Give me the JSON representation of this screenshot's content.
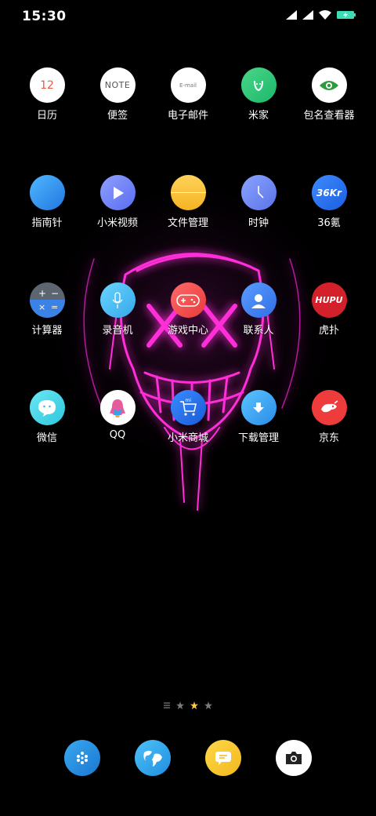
{
  "status_bar": {
    "time": "15:30"
  },
  "rows": [
    [
      {
        "label": "日历",
        "name": "calendar",
        "glyph": "12"
      },
      {
        "label": "便签",
        "name": "notes",
        "glyph": "NOTE"
      },
      {
        "label": "电子邮件",
        "name": "email",
        "glyph": "E-mail"
      },
      {
        "label": "米家",
        "name": "mijia",
        "glyph": ""
      },
      {
        "label": "包名查看器",
        "name": "package-viewer",
        "glyph": ""
      }
    ],
    [
      {
        "label": "指南针",
        "name": "compass",
        "glyph": ""
      },
      {
        "label": "小米视频",
        "name": "mi-video",
        "glyph": ""
      },
      {
        "label": "文件管理",
        "name": "file-manager",
        "glyph": ""
      },
      {
        "label": "时钟",
        "name": "clock",
        "glyph": ""
      },
      {
        "label": "36氪",
        "name": "36kr",
        "glyph": "36Kr"
      }
    ],
    [
      {
        "label": "计算器",
        "name": "calculator",
        "glyph": ""
      },
      {
        "label": "录音机",
        "name": "recorder",
        "glyph": ""
      },
      {
        "label": "游戏中心",
        "name": "game-center",
        "glyph": ""
      },
      {
        "label": "联系人",
        "name": "contacts",
        "glyph": ""
      },
      {
        "label": "虎扑",
        "name": "hupu",
        "glyph": "HUPU"
      }
    ],
    [
      {
        "label": "微信",
        "name": "wechat",
        "glyph": ""
      },
      {
        "label": "QQ",
        "name": "qq",
        "glyph": ""
      },
      {
        "label": "小米商城",
        "name": "mi-store",
        "glyph": "mi"
      },
      {
        "label": "下载管理",
        "name": "downloads",
        "glyph": ""
      },
      {
        "label": "京东",
        "name": "jd",
        "glyph": ""
      }
    ]
  ],
  "dock": [
    {
      "name": "app-drawer",
      "icon": "dots-icon"
    },
    {
      "name": "browser",
      "icon": "globe-icon"
    },
    {
      "name": "messages",
      "icon": "message-icon"
    },
    {
      "name": "camera",
      "icon": "camera-icon"
    }
  ],
  "colors": {
    "accent": "#ffc64a",
    "battery": "#3ddcb4"
  }
}
